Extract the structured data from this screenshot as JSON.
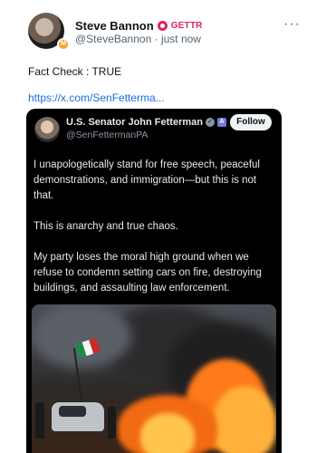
{
  "post": {
    "author_name": "Steve Bannon",
    "gettr_label": "GETTR",
    "handle": "@SteveBannon",
    "separator": "·",
    "time": "just now",
    "more_label": "···",
    "text": "Fact Check : TRUE",
    "link_text": "https://x.com/SenFetterma...",
    "avatar_badge": "M"
  },
  "quote": {
    "name": "U.S. Senator John Fetterman",
    "verified_glyph": "✓",
    "gov_glyph": "A",
    "handle": "@SenFettermanPA",
    "follow_label": "Follow",
    "paragraphs": [
      "I unapologetically stand for free speech, peaceful demonstrations, and immigration—but this is not that.",
      "This is anarchy and true chaos.",
      "My party loses the moral high ground when we refuse to condemn setting cars on fire, destroying buildings, and assaulting law enforcement."
    ]
  },
  "colors": {
    "link": "#1d6fe0",
    "gettr": "#e0245e",
    "quote_bg": "#000000",
    "fire": "#ff7a1a"
  },
  "icons": {
    "gettr": "gettr-icon",
    "more": "more-icon",
    "verified": "verified-badge-icon",
    "government": "government-badge-icon"
  }
}
